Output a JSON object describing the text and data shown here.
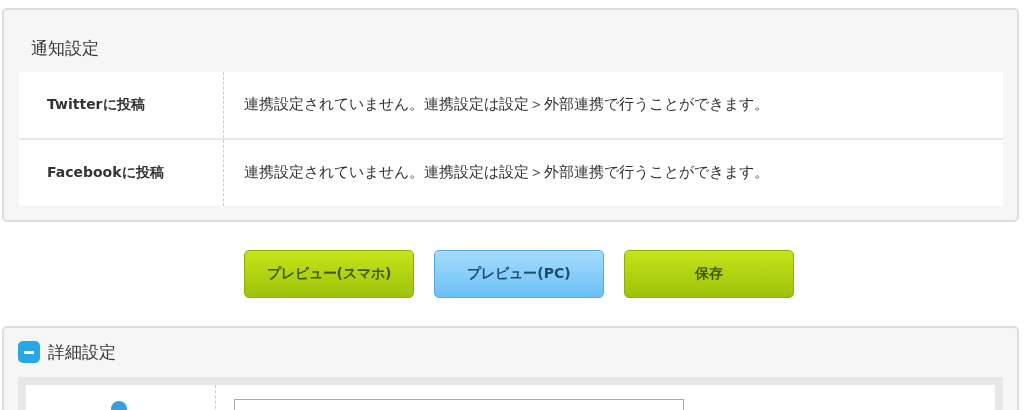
{
  "notification_panel": {
    "title": "通知設定",
    "rows": [
      {
        "label": "Twitterに投稿",
        "value": "連携設定されていません。連携設定は設定＞外部連携で行うことができます。"
      },
      {
        "label": "Facebookに投稿",
        "value": "連携設定されていません。連携設定は設定＞外部連携で行うことができます。"
      }
    ]
  },
  "buttons": [
    {
      "label": "プレビュー(スマホ)",
      "kind": "green"
    },
    {
      "label": "プレビュー(PC)",
      "kind": "blue"
    },
    {
      "label": "保存",
      "kind": "green"
    }
  ],
  "details_panel": {
    "title": "詳細設定",
    "expanded": true
  }
}
